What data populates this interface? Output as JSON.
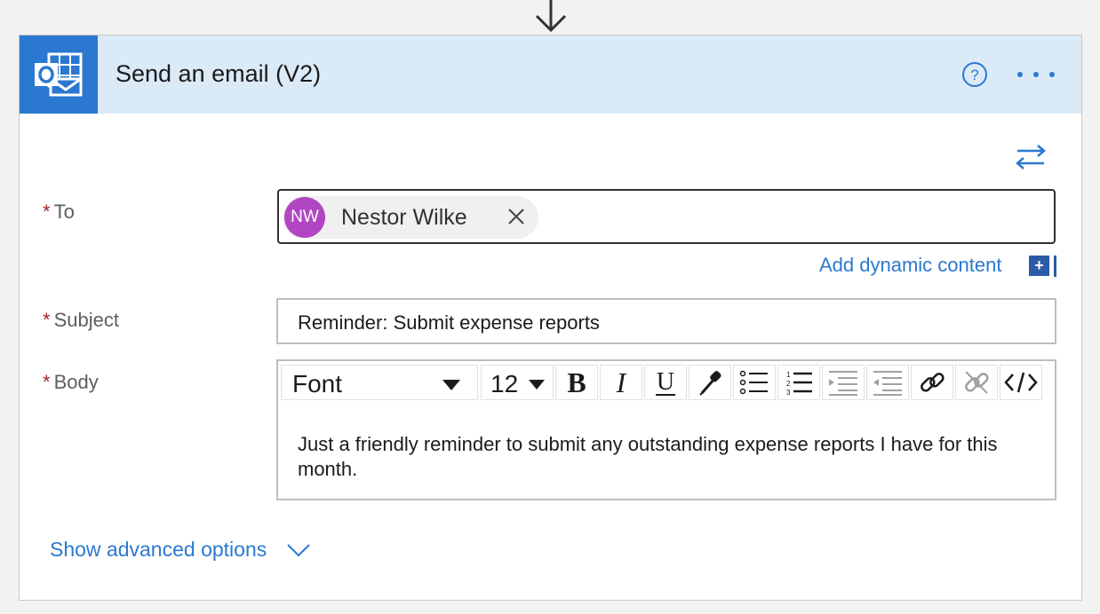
{
  "action": {
    "title": "Send an email (V2)"
  },
  "fields": {
    "to_label": "To",
    "subject_label": "Subject",
    "body_label": "Body",
    "required_marker": "*"
  },
  "to": {
    "recipient_initials": "NW",
    "recipient_name": "Nestor Wilke"
  },
  "dynamic_content": {
    "label": "Add dynamic content",
    "plus": "+"
  },
  "subject": {
    "value": "Reminder: Submit expense reports"
  },
  "body": {
    "font_select": "Font",
    "size_select": "12",
    "text": "Just a friendly reminder to submit any outstanding expense reports I have for this month."
  },
  "advanced": {
    "label": "Show advanced options"
  },
  "icons": {
    "app": "outlook-icon",
    "help": "help-icon",
    "more": "more-options-icon",
    "swap": "swap-icon"
  },
  "colors": {
    "header_bg": "#dbeaf7",
    "app_tile": "#2a78cf",
    "link": "#2b79d0",
    "avatar": "#b146c2",
    "required": "#a4262c"
  }
}
